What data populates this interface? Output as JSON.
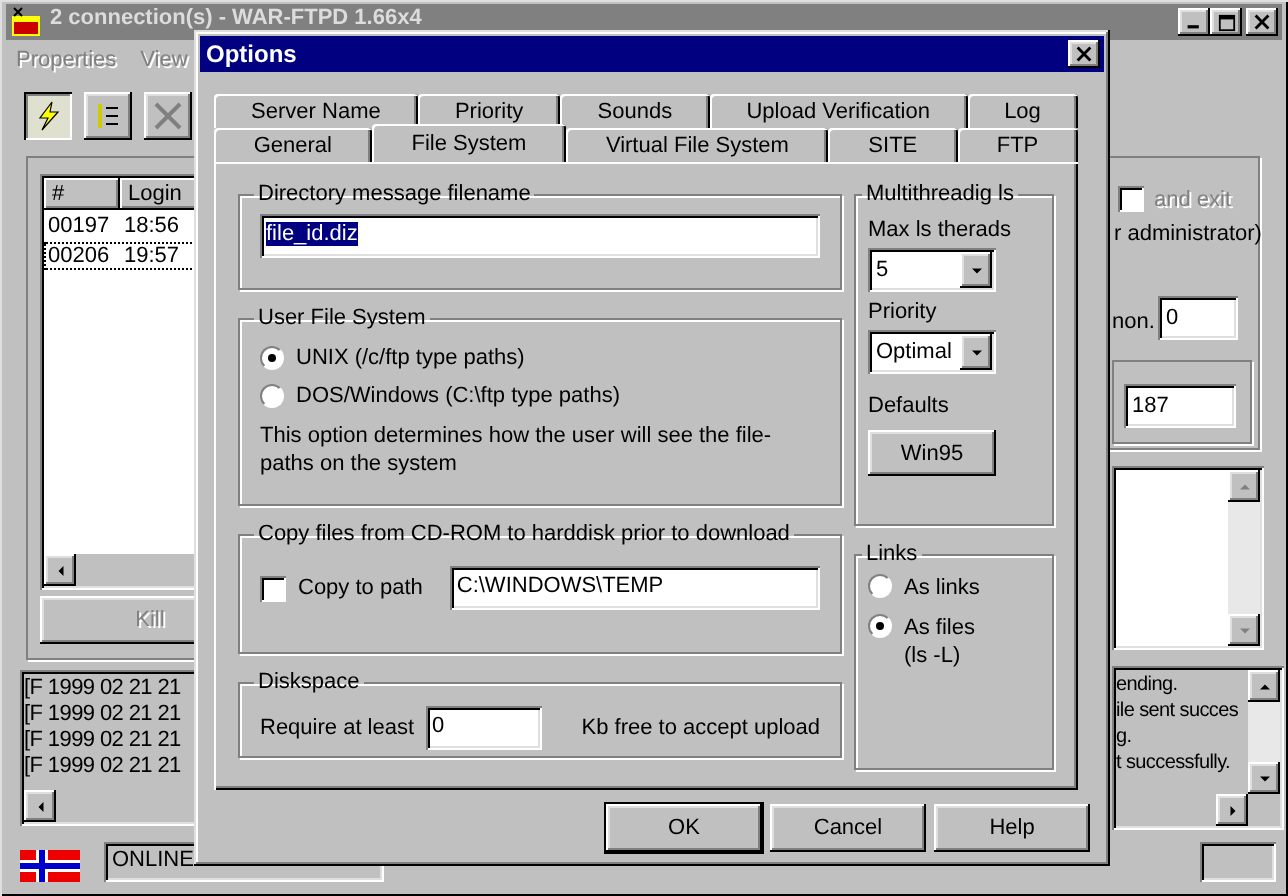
{
  "main_window": {
    "title": "2 connection(s) - WAR-FTPD 1.66x4",
    "menu": [
      {
        "label": "Properties",
        "disabled": true
      },
      {
        "label": "View",
        "disabled": true
      }
    ],
    "connections": {
      "columns": [
        "#",
        "Login"
      ],
      "rows": [
        {
          "cells": [
            "00197",
            "18:56"
          ],
          "focused": false
        },
        {
          "cells": [
            "00206",
            "19:57"
          ],
          "focused": true
        }
      ]
    },
    "kill_button": {
      "label": "Kill",
      "disabled": true
    },
    "log_left": [
      "[F 1999 02 21 21",
      "[F 1999 02 21 21",
      "[F 1999 02 21 21",
      "[F 1999 02 21 21"
    ],
    "status": "ONLINE",
    "exit_checkbox": {
      "label": "and exit",
      "checked": false,
      "disabled": true
    },
    "admin_text": "r administrator)",
    "anon_label": "non.",
    "anon_value": "0",
    "count_value": "187",
    "log_right": [
      "ending.",
      "ile sent succes",
      "g.",
      "t successfully."
    ]
  },
  "dialog": {
    "title": "Options",
    "tab_rows": [
      [
        {
          "label": "Server Name",
          "selected": false
        },
        {
          "label": "Priority",
          "selected": false
        },
        {
          "label": "Sounds",
          "selected": false
        },
        {
          "label": "Upload Verification",
          "selected": false
        },
        {
          "label": "Log",
          "selected": false
        }
      ],
      [
        {
          "label": "General",
          "selected": false
        },
        {
          "label": "File System",
          "selected": true
        },
        {
          "label": "Virtual File System",
          "selected": false
        },
        {
          "label": "SITE",
          "selected": false
        },
        {
          "label": "FTP",
          "selected": false
        }
      ]
    ],
    "directory": {
      "title": "Directory message filename",
      "value": "file_id.diz",
      "selected": true
    },
    "user_fs": {
      "title": "User File System",
      "options": [
        {
          "label": "UNIX (/c/ftp type paths)",
          "selected": true
        },
        {
          "label": "DOS/Windows (C:\\ftp type paths)",
          "selected": false
        }
      ],
      "note": "This option determines how the user will see the file-paths on the system"
    },
    "copy": {
      "title": "Copy files from CD-ROM to harddisk prior to download",
      "checkbox": {
        "label": "Copy to path",
        "checked": false
      },
      "value": "C:\\WINDOWS\\TEMP"
    },
    "diskspace": {
      "title": "Diskspace",
      "label": "Require at least",
      "value": "0",
      "suffix": "Kb free to accept upload"
    },
    "multithread": {
      "title": "Multithreadig ls",
      "max_label": "Max ls therads",
      "max_value": "5",
      "priority_label": "Priority",
      "priority_value": "Optimal",
      "defaults_label": "Defaults",
      "defaults_button": "Win95"
    },
    "links": {
      "title": "Links",
      "options": [
        {
          "label": "As links",
          "selected": false
        },
        {
          "label": "As files (ls -L)",
          "selected": true
        }
      ]
    },
    "buttons": [
      "OK",
      "Cancel",
      "Help"
    ]
  }
}
